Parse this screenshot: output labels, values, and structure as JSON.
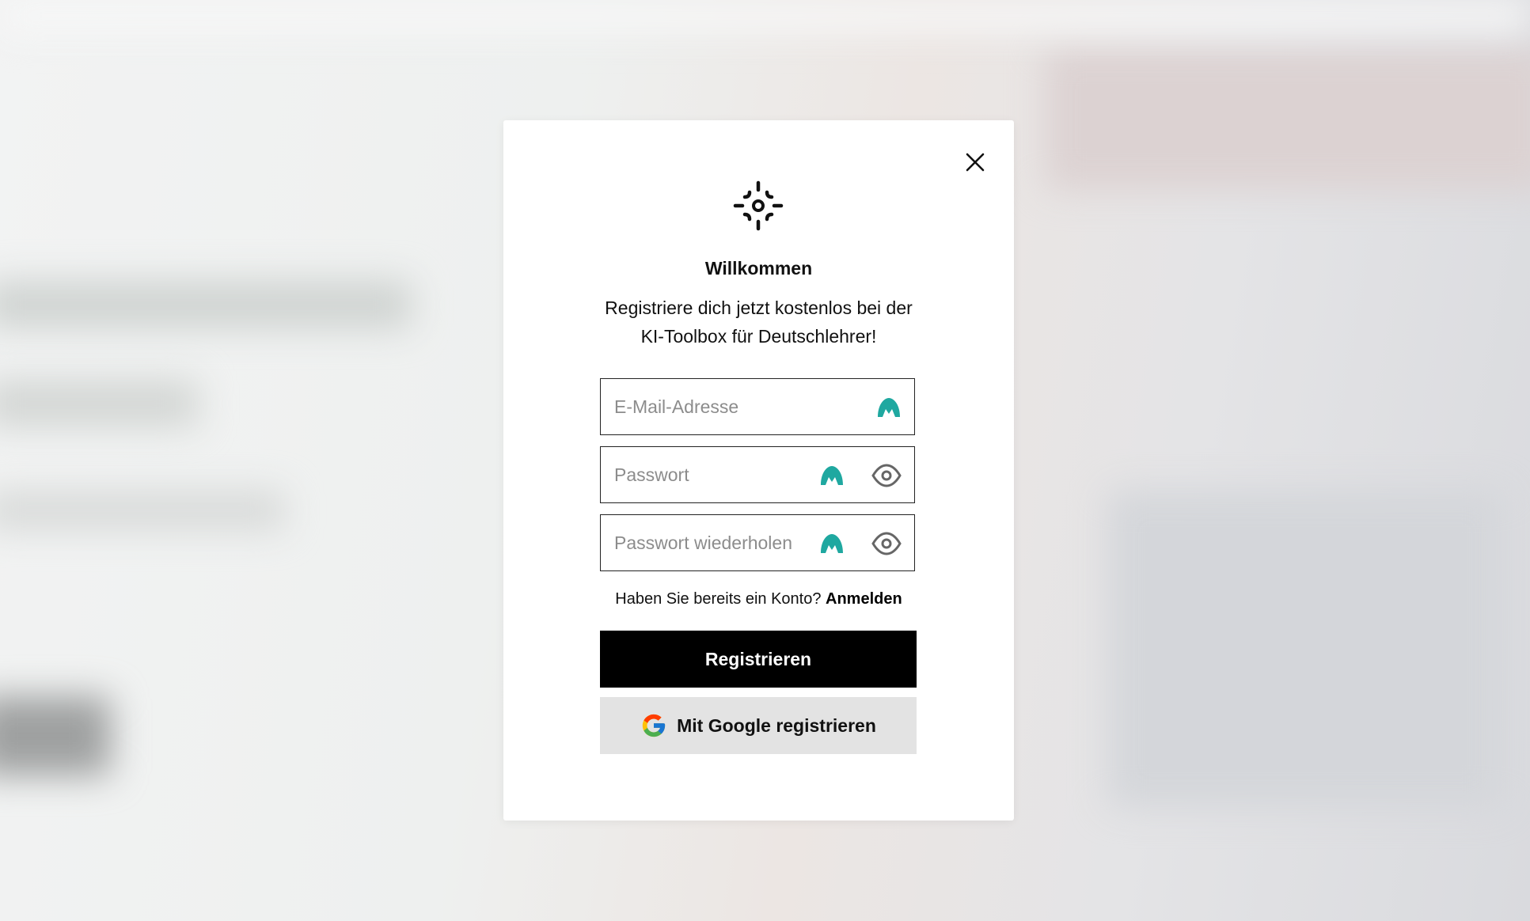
{
  "modal": {
    "title": "Willkommen",
    "subtitle": "Registriere dich jetzt kostenlos bei der KI-Toolbox für Deutschlehrer!",
    "logo_icon": "sparkle-target-icon",
    "close_icon": "close-icon"
  },
  "form": {
    "email": {
      "placeholder": "E-Mail-Adresse",
      "value": ""
    },
    "password": {
      "placeholder": "Passwort",
      "value": ""
    },
    "password_repeat": {
      "placeholder": "Passwort wiederholen",
      "value": ""
    },
    "extension_icon": "password-manager-icon",
    "extension_color": "#1fa8a0",
    "eye_icon": "eye-icon"
  },
  "login_prompt": {
    "text": "Haben Sie bereits ein Konto? ",
    "link": "Anmelden"
  },
  "buttons": {
    "register": "Registrieren",
    "google": "Mit Google registrieren"
  },
  "colors": {
    "primary_button": "#000000",
    "google_button": "#e3e3e3"
  }
}
